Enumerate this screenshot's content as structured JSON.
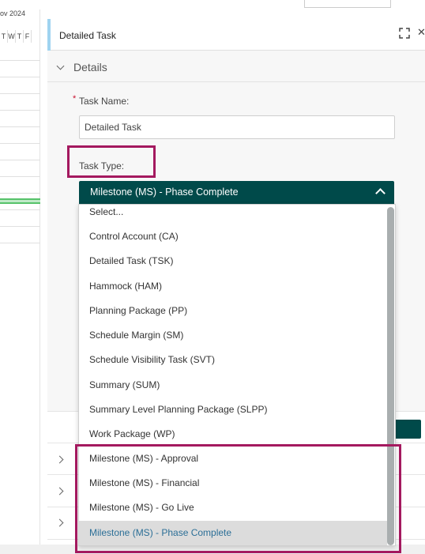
{
  "gantt": {
    "month_label": "ov 2024",
    "day_headers": [
      "T",
      "W",
      "T",
      "F"
    ]
  },
  "panel": {
    "title": "Detailed Task"
  },
  "details": {
    "section_title": "Details",
    "task_name_label": "Task Name:",
    "task_name_value": "Detailed Task",
    "task_type_label": "Task Type:",
    "task_type_selected": "Milestone (MS) - Phase Complete"
  },
  "dropdown": {
    "options": [
      "Select...",
      "Control Account (CA)",
      "Detailed Task (TSK)",
      "Hammock (HAM)",
      "Planning Package (PP)",
      "Schedule Margin (SM)",
      "Schedule Visibility Task (SVT)",
      "Summary (SUM)",
      "Summary Level Planning Package (SLPP)",
      "Work Package (WP)",
      "Milestone (MS) - Approval",
      "Milestone (MS) - Financial",
      "Milestone (MS) - Go Live",
      "Milestone (MS) - Phase Complete"
    ],
    "selected_index": 13
  },
  "colors": {
    "accent_teal": "#004a4a",
    "highlight_magenta": "#a4195f",
    "selected_text": "#2c6f97",
    "required_star": "#c8102e"
  }
}
